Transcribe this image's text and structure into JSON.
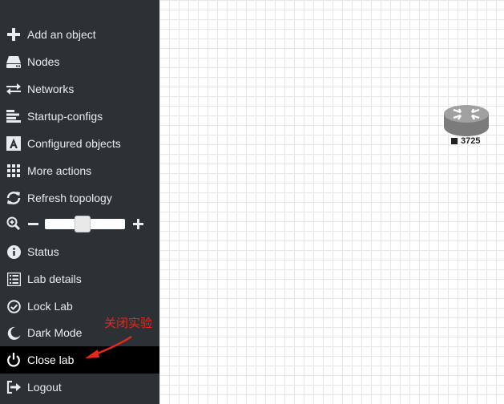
{
  "sidebar": {
    "items": [
      {
        "key": "add-object",
        "label": "Add an object",
        "icon": "plus-icon"
      },
      {
        "key": "nodes",
        "label": "Nodes",
        "icon": "server-icon"
      },
      {
        "key": "networks",
        "label": "Networks",
        "icon": "exchange-icon"
      },
      {
        "key": "startup-configs",
        "label": "Startup-configs",
        "icon": "align-left-icon"
      },
      {
        "key": "configured-objects",
        "label": "Configured objects",
        "icon": "font-icon"
      },
      {
        "key": "more-actions",
        "label": "More actions",
        "icon": "grid-icon"
      },
      {
        "key": "refresh-topology",
        "label": "Refresh topology",
        "icon": "refresh-icon"
      }
    ],
    "zoom": {
      "level_percent": 50
    },
    "items2": [
      {
        "key": "status",
        "label": "Status",
        "icon": "info-icon"
      },
      {
        "key": "lab-details",
        "label": "Lab details",
        "icon": "list-icon"
      },
      {
        "key": "lock-lab",
        "label": "Lock Lab",
        "icon": "check-circle-icon"
      },
      {
        "key": "dark-mode",
        "label": "Dark Mode",
        "icon": "moon-icon"
      },
      {
        "key": "close-lab",
        "label": "Close lab",
        "icon": "power-icon",
        "active": true
      },
      {
        "key": "logout",
        "label": "Logout",
        "icon": "sign-out-icon"
      }
    ]
  },
  "canvas": {
    "nodes": [
      {
        "label": "3725",
        "icon": "router-icon"
      }
    ]
  },
  "annotation": {
    "text": "关闭实验",
    "color": "#e8281c"
  },
  "colors": {
    "sidebar_bg": "#2c3135",
    "active_bg": "#000000",
    "grid_line": "#e6e6e6"
  }
}
